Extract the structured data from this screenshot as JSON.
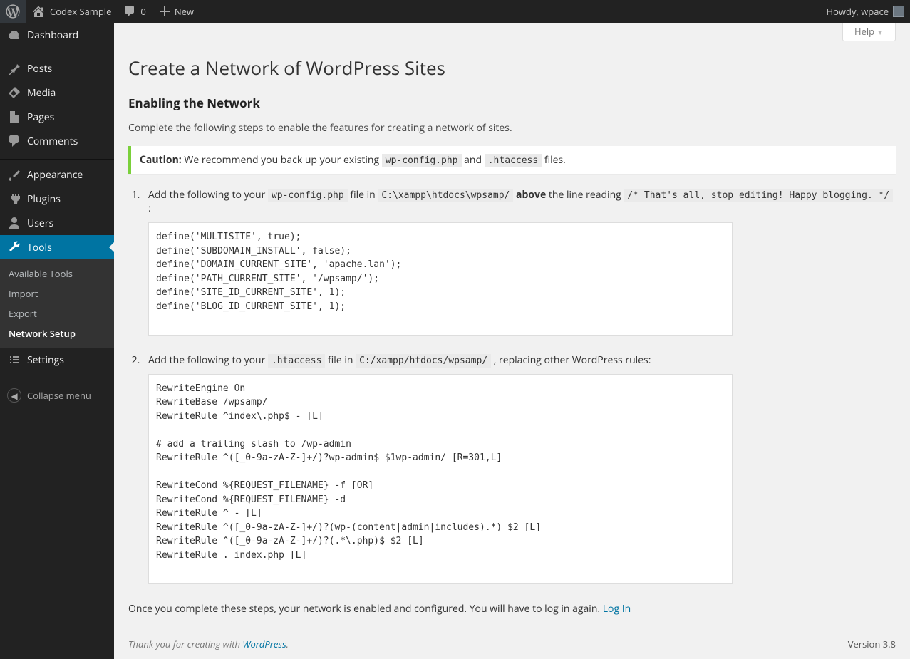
{
  "adminbar": {
    "site_name": "Codex Sample",
    "comments_count": "0",
    "new_label": "New",
    "howdy_prefix": "Howdy, ",
    "username": "wpace"
  },
  "sidebar": {
    "items": [
      {
        "label": "Dashboard"
      },
      {
        "label": "Posts"
      },
      {
        "label": "Media"
      },
      {
        "label": "Pages"
      },
      {
        "label": "Comments"
      },
      {
        "label": "Appearance"
      },
      {
        "label": "Plugins"
      },
      {
        "label": "Users"
      },
      {
        "label": "Tools"
      },
      {
        "label": "Settings"
      }
    ],
    "tools_sub": [
      {
        "label": "Available Tools"
      },
      {
        "label": "Import"
      },
      {
        "label": "Export"
      },
      {
        "label": "Network Setup"
      }
    ],
    "collapse_label": "Collapse menu"
  },
  "help": {
    "label": "Help"
  },
  "page": {
    "title": "Create a Network of WordPress Sites",
    "section_title": "Enabling the Network",
    "desc": "Complete the following steps to enable the features for creating a network of sites.",
    "caution_label": "Caution:",
    "caution_text_1": " We recommend you back up your existing ",
    "caution_code_1": "wp-config.php",
    "caution_text_2": " and ",
    "caution_code_2": ".htaccess",
    "caution_text_3": " files.",
    "step1": {
      "pre": "Add the following to your ",
      "code1": "wp-config.php",
      "mid1": " file in ",
      "code2": "C:\\xampp\\htdocs\\wpsamp/",
      "mid2": " ",
      "bold": "above",
      "mid3": " the line reading ",
      "code3": "/* That's all, stop editing! Happy blogging. */",
      "post": " :",
      "content": "define('MULTISITE', true);\ndefine('SUBDOMAIN_INSTALL', false);\ndefine('DOMAIN_CURRENT_SITE', 'apache.lan');\ndefine('PATH_CURRENT_SITE', '/wpsamp/');\ndefine('SITE_ID_CURRENT_SITE', 1);\ndefine('BLOG_ID_CURRENT_SITE', 1);"
    },
    "step2": {
      "pre": "Add the following to your ",
      "code1": ".htaccess",
      "mid1": " file in ",
      "code2": "C:/xampp/htdocs/wpsamp/",
      "post": " , replacing other WordPress rules:",
      "content": "RewriteEngine On\nRewriteBase /wpsamp/\nRewriteRule ^index\\.php$ - [L]\n\n# add a trailing slash to /wp-admin\nRewriteRule ^([_0-9a-zA-Z-]+/)?wp-admin$ $1wp-admin/ [R=301,L]\n\nRewriteCond %{REQUEST_FILENAME} -f [OR]\nRewriteCond %{REQUEST_FILENAME} -d\nRewriteRule ^ - [L]\nRewriteRule ^([_0-9a-zA-Z-]+/)?(wp-(content|admin|includes).*) $2 [L]\nRewriteRule ^([_0-9a-zA-Z-]+/)?(.*\\.php)$ $2 [L]\nRewriteRule . index.php [L]"
    },
    "final_text": "Once you complete these steps, your network is enabled and configured. You will have to log in again. ",
    "login_link": "Log In"
  },
  "footer": {
    "thanks_pre": "Thank you for creating with ",
    "wp": "WordPress",
    "thanks_post": ".",
    "version": "Version 3.8"
  }
}
